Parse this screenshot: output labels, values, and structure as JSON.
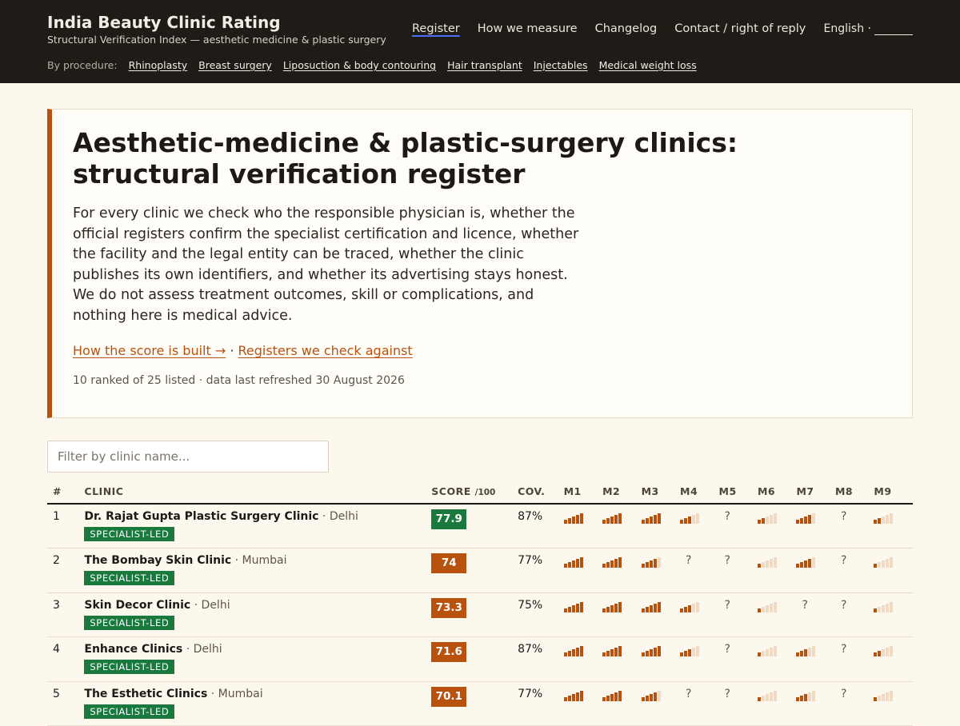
{
  "header": {
    "title": "India Beauty Clinic Rating",
    "subtitle": "Structural Verification Index — aesthetic medicine & plastic surgery",
    "nav": [
      "Register",
      "How we measure",
      "Changelog",
      "Contact / right of reply"
    ],
    "language": "English ·",
    "procedure_label": "By procedure:",
    "procedures": [
      "Rhinoplasty",
      "Breast surgery",
      "Liposuction & body contouring",
      "Hair transplant",
      "Injectables",
      "Medical weight loss"
    ]
  },
  "hero": {
    "heading": "Aesthetic-medicine & plastic-surgery clinics: structural verification register",
    "lead": "For every clinic we check who the responsible physician is, whether the official registers confirm the specialist certification and licence, whether the facility and the legal entity can be traced, whether the clinic publishes its own identifiers, and whether its advertising stays honest. We do not assess treatment outcomes, skill or complications, and nothing here is medical advice.",
    "link_score": "How the score is built →",
    "link_sep": " · ",
    "link_registers": "Registers we check against",
    "meta": "10 ranked of 25 listed · data last refreshed 30 August 2026"
  },
  "filter": {
    "placeholder": "Filter by clinic name..."
  },
  "table": {
    "headers": {
      "rank": "#",
      "clinic": "CLINIC",
      "score": "SCORE",
      "score_unit": "/100",
      "coverage": "COV."
    },
    "metrics": [
      "M1",
      "M2",
      "M3",
      "M4",
      "M5",
      "M6",
      "M7",
      "M8",
      "M9"
    ],
    "unknown_symbol": "?",
    "colors": {
      "bar_on": "#b9510f",
      "bar_off": "#f1d9c4",
      "score_green": "#1a7a3e",
      "score_orange": "#b9510f"
    },
    "rows": [
      {
        "rank": "1",
        "name": "Dr. Rajat Gupta Plastic Surgery Clinic",
        "city": " · Delhi",
        "badge": "SPECIALIST-LED",
        "score": "77.9",
        "score_color": "green",
        "coverage": "87%",
        "m": [
          5,
          5,
          5,
          3,
          null,
          2,
          4,
          null,
          2
        ]
      },
      {
        "rank": "2",
        "name": "The Bombay Skin Clinic",
        "city": " · Mumbai",
        "badge": "SPECIALIST-LED",
        "score": "74",
        "score_color": "orange",
        "coverage": "77%",
        "m": [
          5,
          5,
          4,
          null,
          null,
          1,
          4,
          null,
          1
        ]
      },
      {
        "rank": "3",
        "name": "Skin Decor Clinic",
        "city": " · Delhi",
        "badge": "SPECIALIST-LED",
        "score": "73.3",
        "score_color": "orange",
        "coverage": "75%",
        "m": [
          5,
          5,
          5,
          3,
          null,
          1,
          null,
          null,
          1
        ]
      },
      {
        "rank": "4",
        "name": "Enhance Clinics",
        "city": " · Delhi",
        "badge": "SPECIALIST-LED",
        "score": "71.6",
        "score_color": "orange",
        "coverage": "87%",
        "m": [
          5,
          5,
          5,
          3,
          null,
          1,
          3,
          null,
          2
        ]
      },
      {
        "rank": "5",
        "name": "The Esthetic Clinics",
        "city": " · Mumbai",
        "badge": "SPECIALIST-LED",
        "score": "70.1",
        "score_color": "orange",
        "coverage": "77%",
        "m": [
          5,
          5,
          4,
          null,
          null,
          1,
          3,
          null,
          1
        ]
      }
    ]
  }
}
